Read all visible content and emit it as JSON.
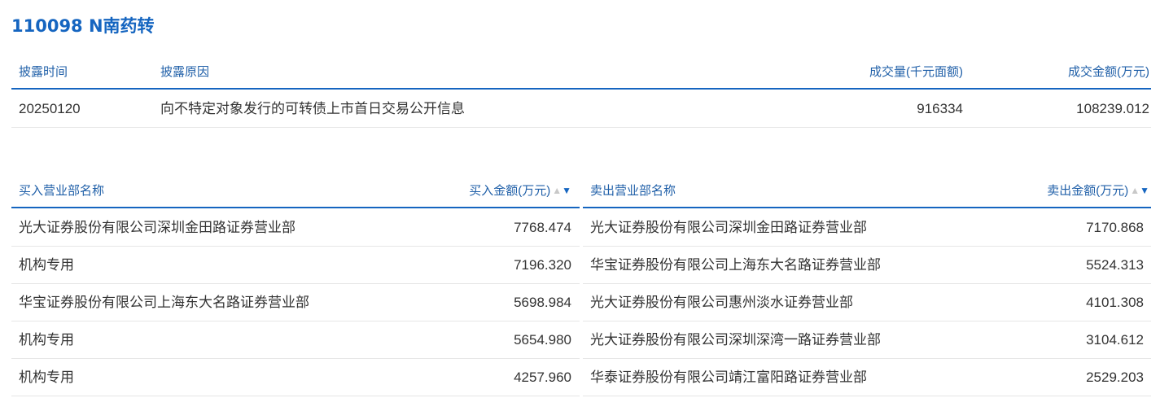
{
  "title": "110098 N南药转",
  "disclosure": {
    "headers": {
      "date": "披露时间",
      "reason": "披露原因",
      "volume": "成交量(千元面额)",
      "amount": "成交金额(万元)"
    },
    "rows": [
      {
        "date": "20250120",
        "reason": "向不特定对象发行的可转债上市首日交易公开信息",
        "volume": "916334",
        "amount": "108239.012"
      }
    ]
  },
  "buy": {
    "headers": {
      "name": "买入营业部名称",
      "amount": "买入金额(万元)"
    },
    "sort_up": "▲",
    "sort_down": "▼",
    "rows": [
      {
        "name": "光大证券股份有限公司深圳金田路证券营业部",
        "amount": "7768.474"
      },
      {
        "name": "机构专用",
        "amount": "7196.320"
      },
      {
        "name": "华宝证券股份有限公司上海东大名路证券营业部",
        "amount": "5698.984"
      },
      {
        "name": "机构专用",
        "amount": "5654.980"
      },
      {
        "name": "机构专用",
        "amount": "4257.960"
      }
    ]
  },
  "sell": {
    "headers": {
      "name": "卖出营业部名称",
      "amount": "卖出金额(万元)"
    },
    "sort_up": "▲",
    "sort_down": "▼",
    "rows": [
      {
        "name": "光大证券股份有限公司深圳金田路证券营业部",
        "amount": "7170.868"
      },
      {
        "name": "华宝证券股份有限公司上海东大名路证券营业部",
        "amount": "5524.313"
      },
      {
        "name": "光大证券股份有限公司惠州淡水证券营业部",
        "amount": "4101.308"
      },
      {
        "name": "光大证券股份有限公司深圳深湾一路证券营业部",
        "amount": "3104.612"
      },
      {
        "name": "华泰证券股份有限公司靖江富阳路证券营业部",
        "amount": "2529.203"
      }
    ]
  },
  "colors": {
    "accent": "#1565c0",
    "header_text": "#1f5fa8",
    "body_text": "#333333",
    "row_border": "#e6e6e6"
  }
}
